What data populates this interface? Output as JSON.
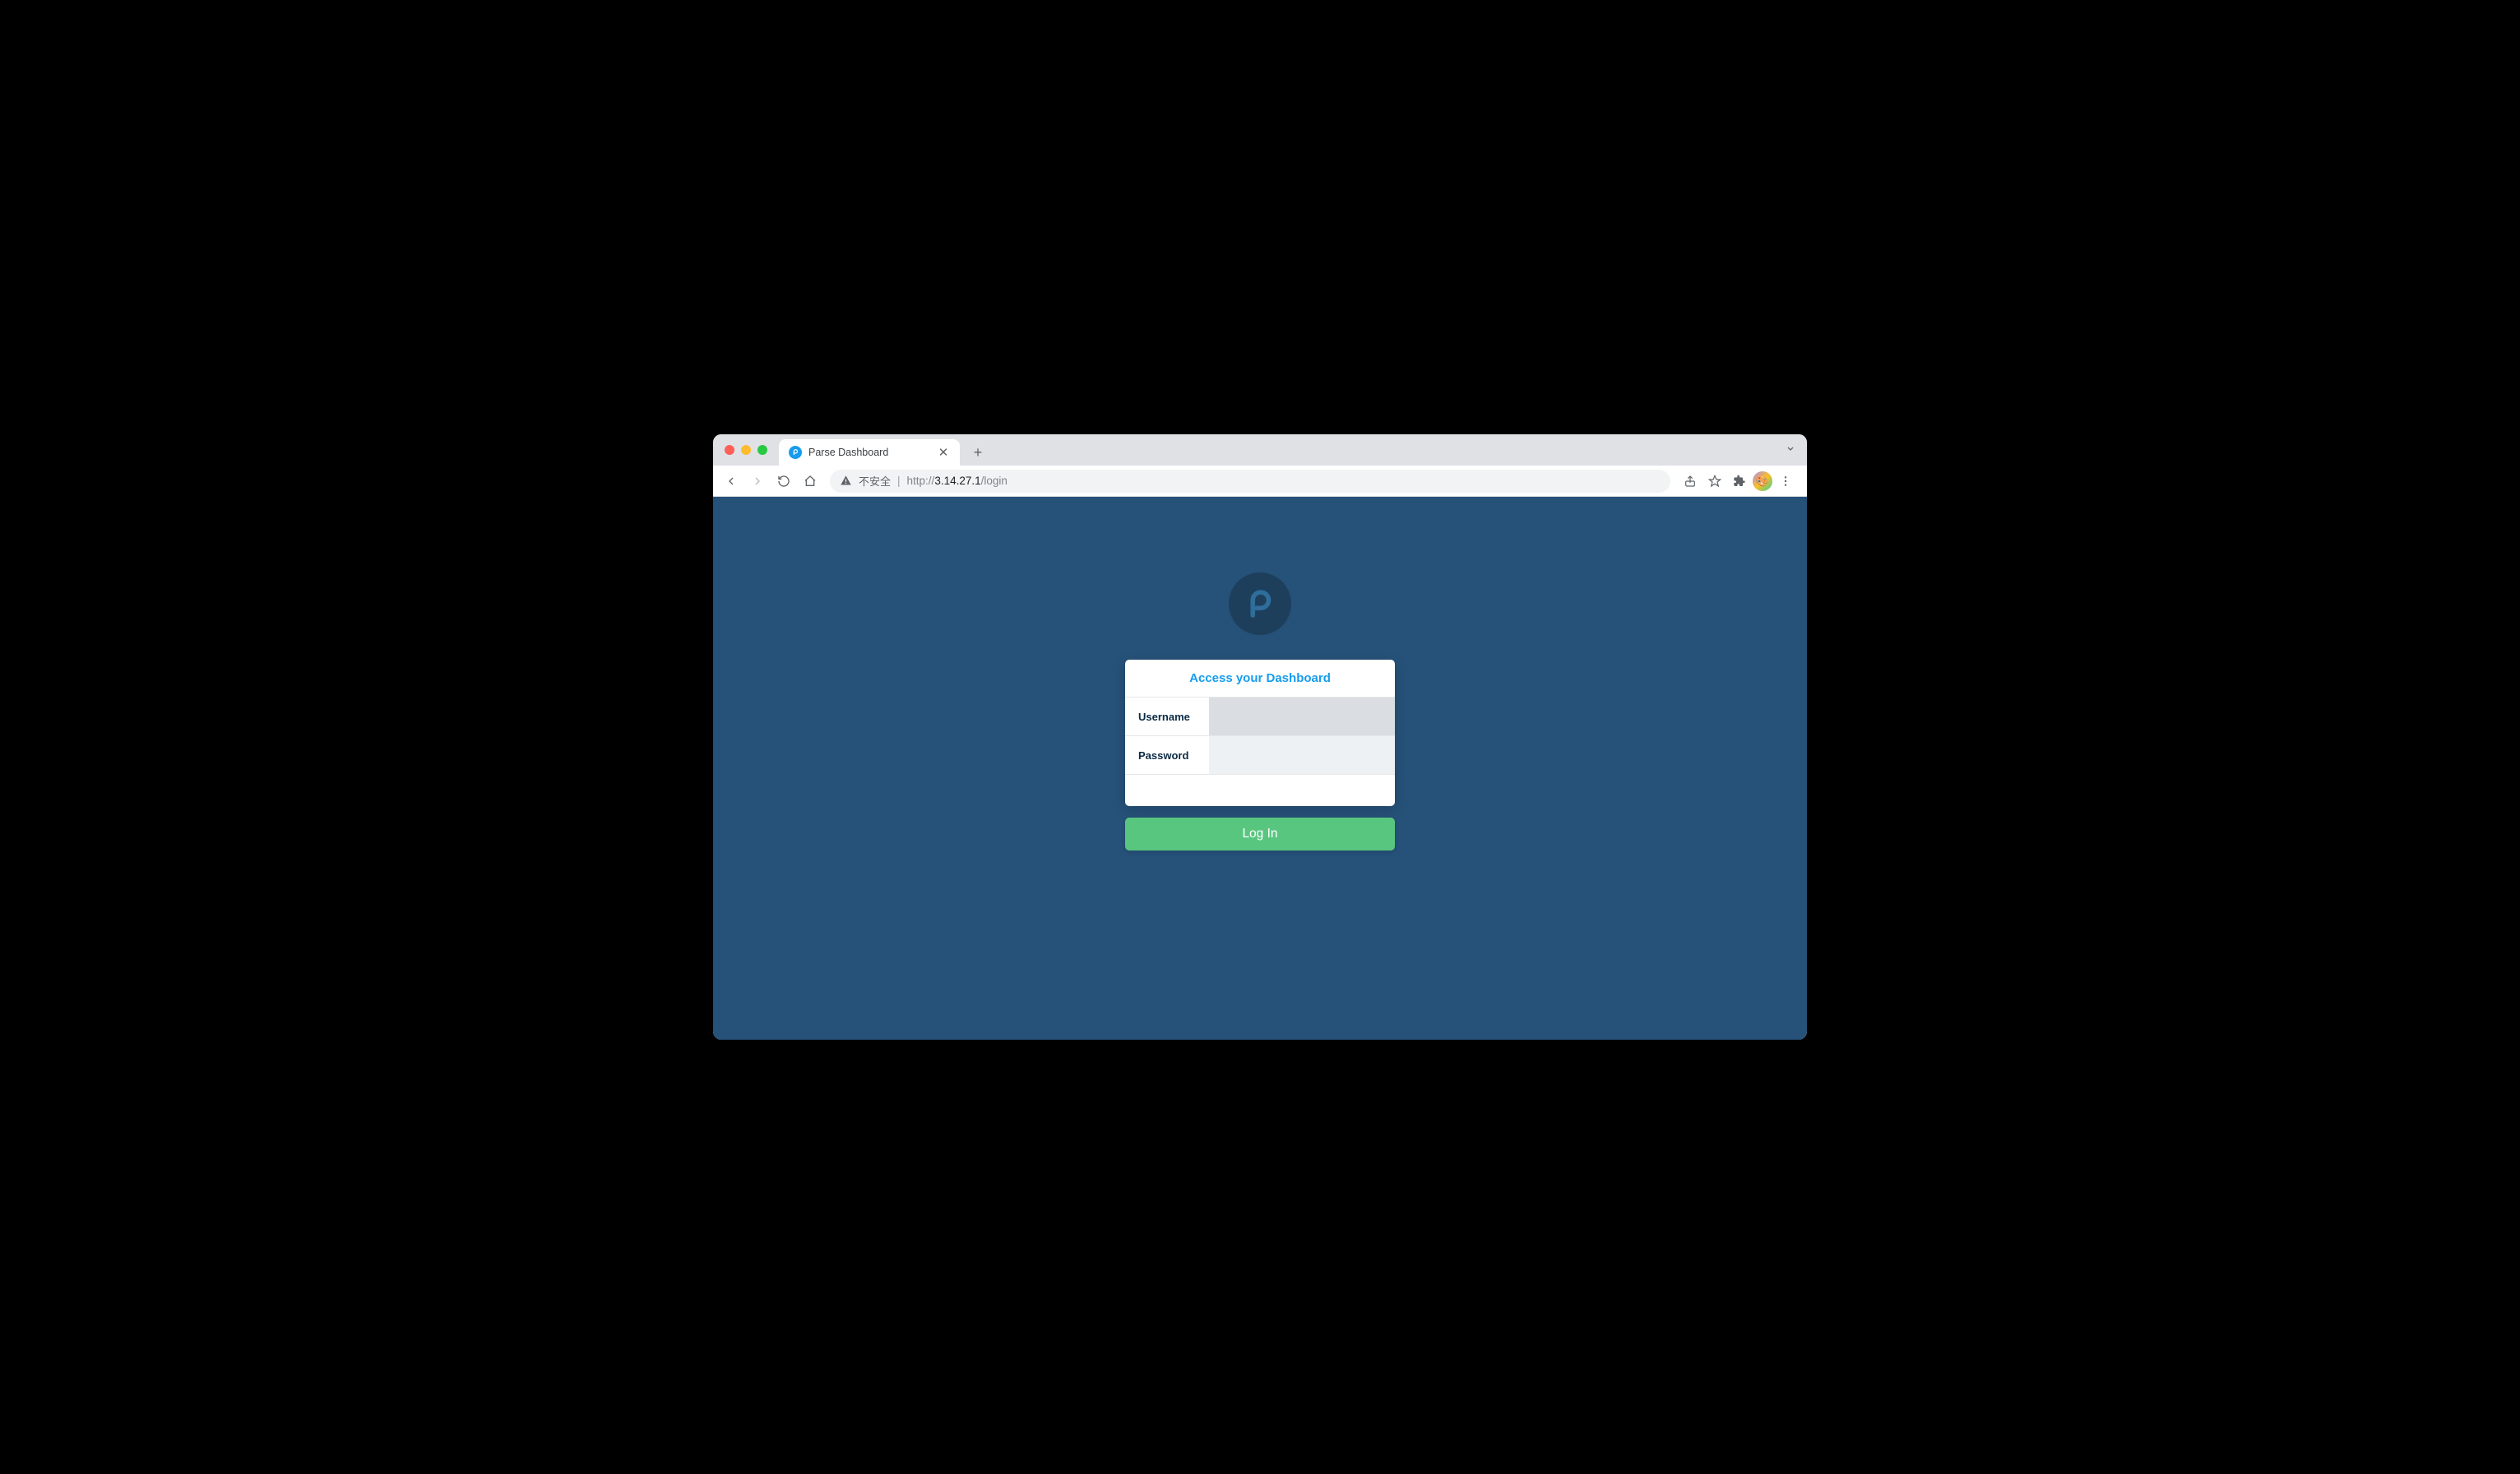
{
  "browser": {
    "tab_title": "Parse Dashboard",
    "security_label": "不安全",
    "url_scheme": "http://",
    "url_host": "3.14.27.1",
    "url_path": "/login"
  },
  "login": {
    "heading": "Access your Dashboard",
    "username_label": "Username",
    "username_value": "",
    "password_label": "Password",
    "password_value": "",
    "submit_label": "Log In"
  },
  "colors": {
    "page_bg": "#265178",
    "accent": "#169cee",
    "button": "#59c680"
  }
}
